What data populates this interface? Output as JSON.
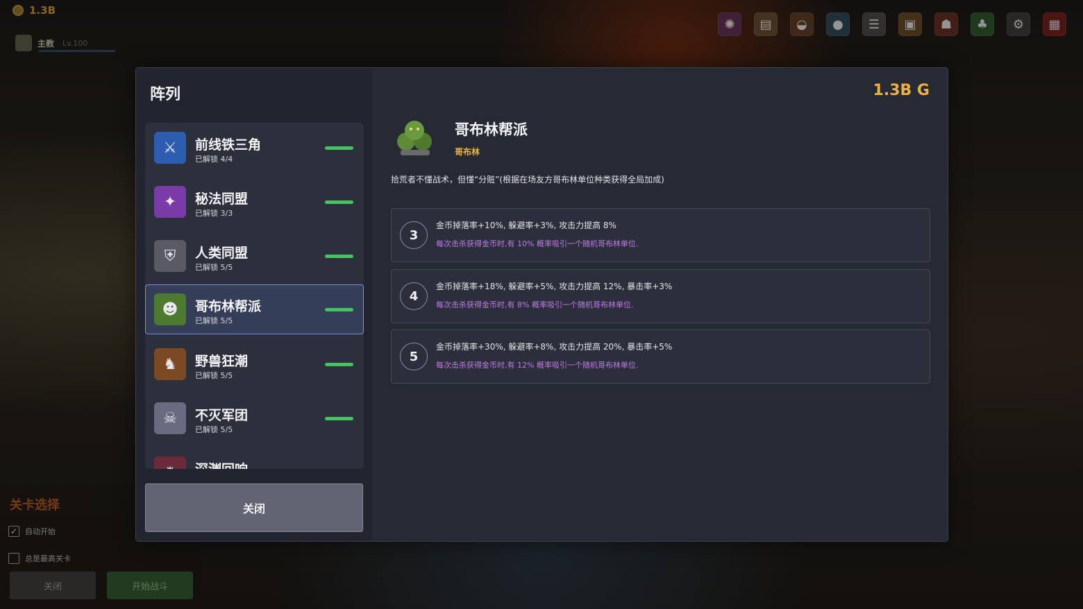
{
  "hud": {
    "gold": "1.3B",
    "player_name": "主教",
    "player_level": "Lv.100"
  },
  "top_icons": [
    "portal-icon",
    "scroll-icon",
    "helmet-icon",
    "orb-icon",
    "list-icon",
    "book-icon",
    "mask-icon",
    "tree-icon",
    "gear-icon",
    "save-icon"
  ],
  "stage_panel": {
    "title": "关卡选择",
    "auto_start": "自动开始",
    "auto_start_checked": true,
    "highest_stage": "总是最高关卡",
    "highest_stage_checked": false,
    "close": "关闭",
    "start_battle": "开始战斗"
  },
  "modal": {
    "title": "阵列",
    "gold_total": "1.3B G",
    "close": "关闭",
    "formations": [
      {
        "name": "前线铁三角",
        "unlocked": "已解锁 4/4",
        "icon": "knight-icon",
        "color": "#2c5db0",
        "selected": false
      },
      {
        "name": "秘法同盟",
        "unlocked": "已解锁 3/3",
        "icon": "arcane-icon",
        "color": "#7a3aa8",
        "selected": false
      },
      {
        "name": "人类同盟",
        "unlocked": "已解锁 5/5",
        "icon": "human-helm-icon",
        "color": "#5a5a62",
        "selected": false
      },
      {
        "name": "哥布林帮派",
        "unlocked": "已解锁 5/5",
        "icon": "goblin-icon",
        "color": "#4d7a2e",
        "selected": true
      },
      {
        "name": "野兽狂潮",
        "unlocked": "已解锁 5/5",
        "icon": "beast-icon",
        "color": "#7a4a22",
        "selected": false
      },
      {
        "name": "不灭军团",
        "unlocked": "已解锁 5/5",
        "icon": "undead-icon",
        "color": "#6a6a80",
        "selected": false
      },
      {
        "name": "深渊回响",
        "unlocked": "",
        "icon": "abyss-icon",
        "color": "#6a2a3a",
        "selected": false
      }
    ],
    "detail": {
      "name": "哥布林帮派",
      "tag": "哥布林",
      "icon": "goblin-group-icon",
      "description": "拾荒者不懂战术，但懂“分赃”(根据在场友方哥布林单位种类获得全局加成)",
      "tiers": [
        {
          "count": "3",
          "effect": "金币掉落率+10%, 躲避率+3%, 攻击力提高 8%",
          "extra": "每次击杀获得金币时,有 10% 概率吸引一个随机哥布林单位."
        },
        {
          "count": "4",
          "effect": "金币掉落率+18%, 躲避率+5%, 攻击力提高 12%, 暴击率+3%",
          "extra": "每次击杀获得金币时,有 8% 概率吸引一个随机哥布林单位."
        },
        {
          "count": "5",
          "effect": "金币掉落率+30%, 躲避率+8%, 攻击力提高 20%, 暴击率+5%",
          "extra": "每次击杀获得金币时,有 12% 概率吸引一个随机哥布林单位."
        }
      ]
    }
  }
}
